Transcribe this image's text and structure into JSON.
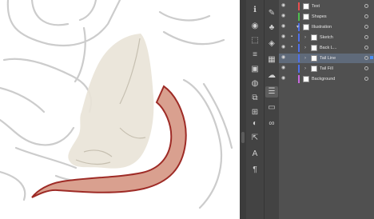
{
  "colors": {
    "canvas_bg": "#ffffff",
    "sketch_stroke": "#cccccc",
    "body_fill": "#e9e4d8",
    "tail_fill": "#d9a08f",
    "tail_stroke": "#9e2b26",
    "panel_bg": "#505050",
    "selected_row": "#5f6a7a"
  },
  "tools": [
    {
      "name": "info-icon",
      "glyph": "ℹ"
    },
    {
      "name": "color-icon",
      "glyph": "◉"
    },
    {
      "name": "transform-icon",
      "glyph": "⬚"
    },
    {
      "name": "stroke-icon",
      "glyph": "≡"
    },
    {
      "name": "gradient-icon",
      "glyph": "▣"
    },
    {
      "name": "appearance-icon",
      "glyph": "◍"
    },
    {
      "name": "align-icon",
      "glyph": "⧉"
    },
    {
      "name": "pathfinder-icon",
      "glyph": "⊞"
    },
    {
      "name": "transparency-icon",
      "glyph": "◐"
    },
    {
      "name": "export-icon",
      "glyph": "⇱"
    },
    {
      "name": "character-icon",
      "glyph": "A"
    },
    {
      "name": "paragraph-icon",
      "glyph": "¶"
    }
  ],
  "tools2": [
    {
      "name": "brushes-icon",
      "glyph": "✎"
    },
    {
      "name": "symbols-icon",
      "glyph": "♣"
    },
    {
      "name": "graphic-styles-icon",
      "glyph": "◈"
    },
    {
      "name": "swatches-icon",
      "glyph": "▦"
    },
    {
      "name": "libraries-icon",
      "glyph": "☁"
    },
    {
      "name": "layers-icon",
      "glyph": "☰"
    },
    {
      "name": "artboards-icon",
      "glyph": "▭"
    },
    {
      "name": "links-icon",
      "glyph": "∞"
    }
  ],
  "layers": {
    "rows": [
      {
        "label": "Text",
        "color": "#e84f4f",
        "indent": 0,
        "expand": "",
        "locked": false,
        "selected": false
      },
      {
        "label": "Shapes",
        "color": "#4fbf4f",
        "indent": 0,
        "expand": "",
        "locked": false,
        "selected": false
      },
      {
        "label": "Illustration",
        "color": "#4f6fe8",
        "indent": 0,
        "expand": "▾",
        "locked": false,
        "selected": false
      },
      {
        "label": "Sketch",
        "color": "#4f6fe8",
        "indent": 1,
        "expand": "›",
        "locked": true,
        "selected": false
      },
      {
        "label": "Back L...",
        "color": "#4f6fe8",
        "indent": 1,
        "expand": "›",
        "locked": true,
        "selected": false
      },
      {
        "label": "Tail Line",
        "color": "#4f6fe8",
        "indent": 1,
        "expand": "›",
        "locked": false,
        "selected": true
      },
      {
        "label": "Tail Fill",
        "color": "#4f6fe8",
        "indent": 1,
        "expand": "›",
        "locked": false,
        "selected": false
      },
      {
        "label": "Background",
        "color": "#c86ae0",
        "indent": 0,
        "expand": "",
        "locked": false,
        "selected": false
      }
    ]
  }
}
